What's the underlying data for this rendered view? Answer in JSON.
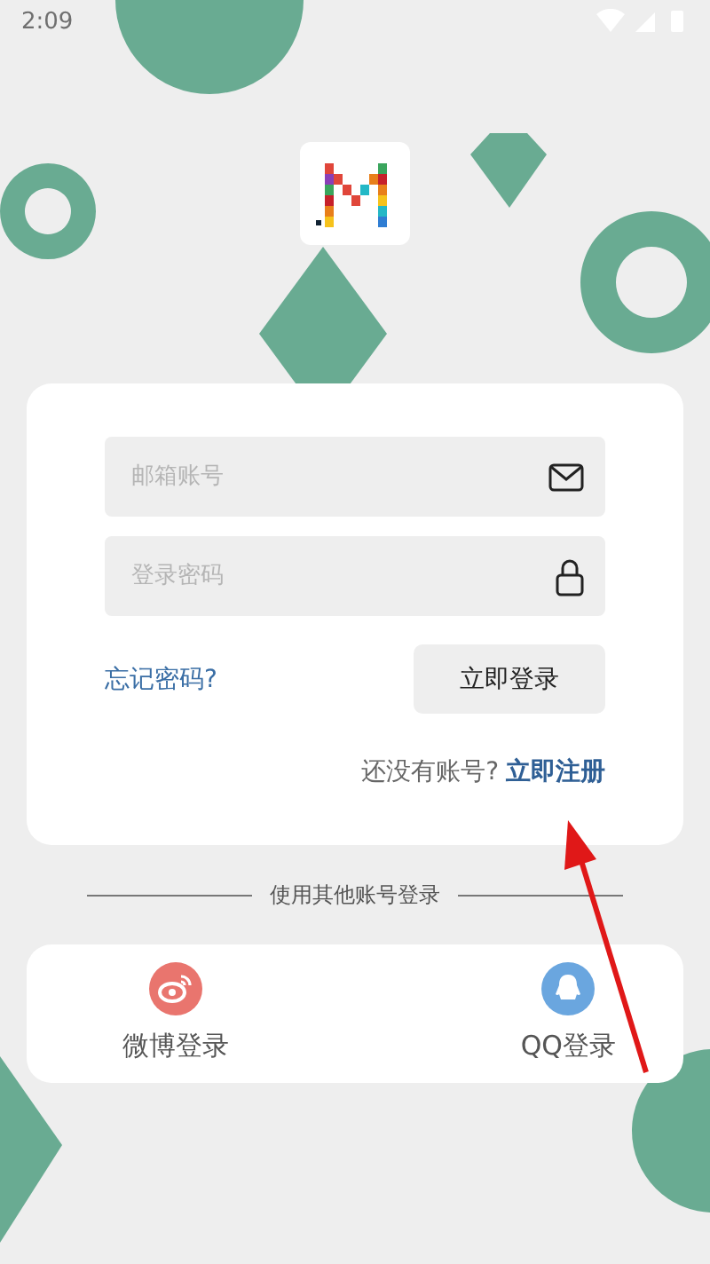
{
  "status_bar": {
    "time": "2:09"
  },
  "login_form": {
    "email_field": {
      "placeholder": "邮箱账号"
    },
    "password_field": {
      "placeholder": "登录密码"
    },
    "forgot_link": "忘记密码?",
    "login_button": "立即登录",
    "register_prompt": "还没有账号?",
    "register_link": "立即注册"
  },
  "divider_label": "使用其他账号登录",
  "social_logins": [
    {
      "kind": "weibo",
      "label": "微博登录",
      "color": "#e9756e"
    },
    {
      "kind": "qq",
      "label": "QQ登录",
      "color": "#6aa6df"
    }
  ]
}
